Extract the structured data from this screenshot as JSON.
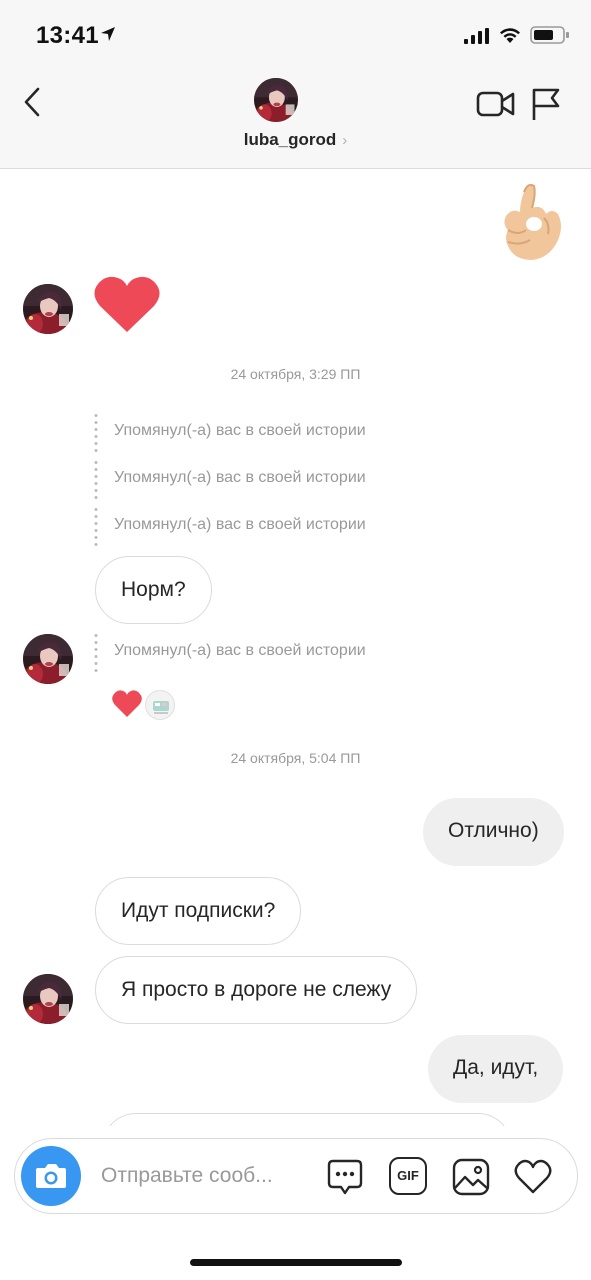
{
  "status_bar": {
    "time": "13:41",
    "icons": [
      "location-arrow-icon",
      "cell-signal-icon",
      "wifi-icon",
      "battery-icon"
    ]
  },
  "header": {
    "username": "luba_gorod",
    "chevron": "›",
    "icons": [
      "back-chevron-icon",
      "video-call-icon",
      "flag-icon"
    ]
  },
  "messages": {
    "ts1": "24 октября, 3:29 ПП",
    "mention_text": "Упомянул(-а) вас в своей истории",
    "norm": "Норм?",
    "ts2": "24 октября, 5:04 ПП",
    "otlichno": "Отлично)",
    "idut_podpiski": "Идут подписки?",
    "ya_prosto": "Я просто в дороге не слежу",
    "da_idut": "Да, идут,"
  },
  "composer": {
    "placeholder": "Отправьте сооб...",
    "icons": [
      "camera-icon",
      "chat-sticker-icon",
      "gif-icon",
      "gallery-icon",
      "heart-icon"
    ],
    "gif_label": "GIF"
  },
  "colors": {
    "accent_blue": "#3897f0",
    "heart_red": "#ed4956",
    "bubble_out": "#efefef",
    "meta_gray": "#999999"
  }
}
